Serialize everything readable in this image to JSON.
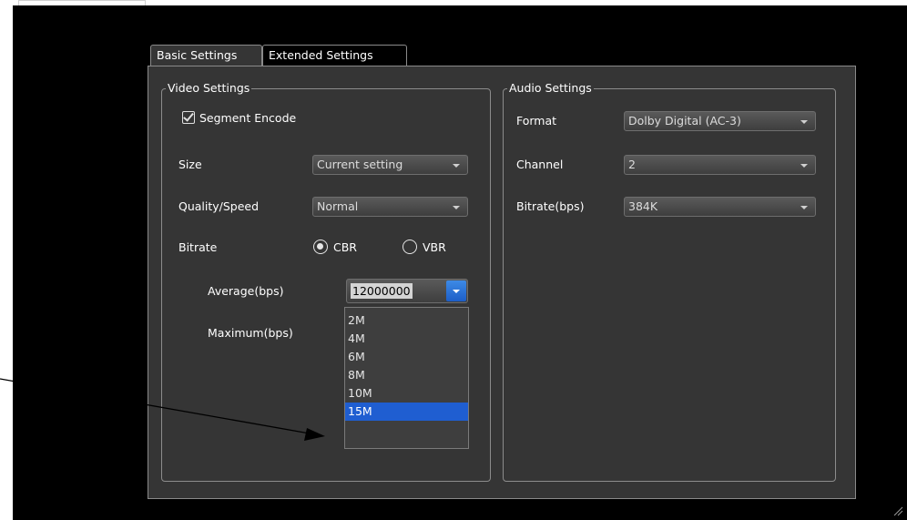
{
  "tabs": [
    {
      "label": "Basic Settings",
      "active": true
    },
    {
      "label": "Extended Settings",
      "active": false
    }
  ],
  "video": {
    "title": "Video Settings",
    "segment_encode": {
      "label": "Segment Encode",
      "checked": true
    },
    "size": {
      "label": "Size",
      "value": "Current setting"
    },
    "quality": {
      "label": "Quality/Speed",
      "value": "Normal"
    },
    "bitrate": {
      "label": "Bitrate",
      "cbr_label": "CBR",
      "vbr_label": "VBR",
      "selected": "CBR"
    },
    "average": {
      "label": "Average(bps)",
      "value": "12000000"
    },
    "maximum": {
      "label": "Maximum(bps)"
    },
    "dropdown_options": [
      "2M",
      "4M",
      "6M",
      "8M",
      "10M",
      "15M"
    ],
    "dropdown_highlighted": "15M"
  },
  "audio": {
    "title": "Audio Settings",
    "format": {
      "label": "Format",
      "value": "Dolby Digital (AC-3)"
    },
    "channel": {
      "label": "Channel",
      "value": "2"
    },
    "bitrate": {
      "label": "Bitrate(bps)",
      "value": "384K"
    }
  },
  "colors": {
    "panel_bg": "#353535",
    "window_bg": "#000000",
    "selection": "#1f5ed1",
    "dropdown_button": "#2a6fd8"
  }
}
